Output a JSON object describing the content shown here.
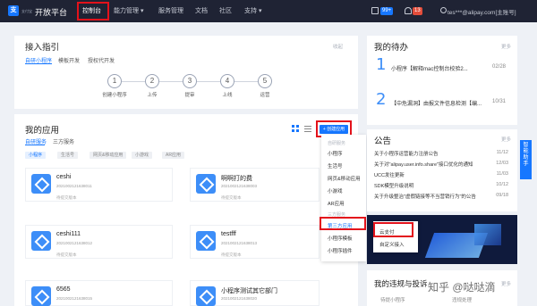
{
  "nav": {
    "logo_brand": "支付宝",
    "title": "开放平台",
    "items": [
      "控制台",
      "能力管理",
      "服务管理",
      "文档",
      "社区",
      "支持"
    ],
    "badge_a": "99+",
    "badge_b": "13",
    "user": "tes***@alipay.com[主账号]"
  },
  "guide": {
    "title": "接入指引",
    "more": "收起",
    "tabs": [
      "自研小程序",
      "模板开发",
      "授权代开发"
    ],
    "steps": [
      {
        "num": "1",
        "label": "创建小程序"
      },
      {
        "num": "2",
        "label": "上传"
      },
      {
        "num": "3",
        "label": "提审"
      },
      {
        "num": "4",
        "label": "上线"
      },
      {
        "num": "5",
        "label": "运营"
      }
    ]
  },
  "apps": {
    "title": "我的应用",
    "tabs": [
      "自研服务",
      "三方服务"
    ],
    "filters": [
      "小程序",
      "生活号",
      "网页&移动应用",
      "小游戏",
      "AR应用"
    ],
    "create_label": "+ 创建应用",
    "list": [
      {
        "name": "ceshi",
        "id": "2021002121638011",
        "status": "待提交版本"
      },
      {
        "name": "啊啊打的费",
        "id": "2021002121638003",
        "status": "待提交版本"
      },
      {
        "name": "ceshi111",
        "id": "2021002121638012",
        "status": "待提交版本"
      },
      {
        "name": "testfff",
        "id": "2021002121638013",
        "status": "待提交版本"
      },
      {
        "name": "6565",
        "id": "2021002121638015",
        "status": ""
      },
      {
        "name": "小程序测试其它部门",
        "id": "2021002121638020",
        "status": ""
      }
    ]
  },
  "dropdown": {
    "group_self": "自研服务",
    "self_items": [
      "小程序",
      "生活号",
      "网页&移动应用",
      "小游戏",
      "AR应用"
    ],
    "group_third": "三方服务",
    "third_items": [
      "第三方应用",
      "小程序模板",
      "小程序插件"
    ],
    "sub_items": [
      "云支付",
      "自定义接入"
    ]
  },
  "todo": {
    "title": "我的待办",
    "more": "更多",
    "items": [
      {
        "num": "1",
        "text": "小程序【解释mac控制台校验2...",
        "date": "02/28"
      },
      {
        "num": "2",
        "text": "【中危漏洞】由报文件信息检测【编...",
        "date": "10/31"
      }
    ]
  },
  "notice": {
    "title": "公告",
    "more": "更多",
    "items": [
      {
        "text": "关于小程序运营能力注册公告",
        "date": "11/12"
      },
      {
        "text": "关于对\"alipay.user.info.share\"接口优化的通知",
        "date": "12/03"
      },
      {
        "text": "UCC发往更新",
        "date": "11/03"
      },
      {
        "text": "SDK模型升级说明",
        "date": "10/12"
      },
      {
        "text": "关于升级整治\"虚假链接等不当营销行为\"的公告",
        "date": "09/18"
      }
    ]
  },
  "violation": {
    "title": "我的违规与投诉",
    "more": "更多",
    "tabs": [
      "待提小程序",
      "违规处理"
    ]
  },
  "float_label": "智能助手",
  "watermark": "知乎 @哒哒滴"
}
